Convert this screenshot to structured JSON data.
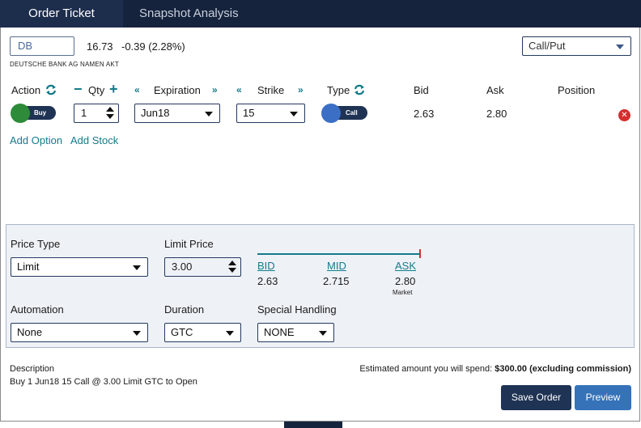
{
  "tabs": [
    {
      "label": "Order Ticket",
      "active": true
    },
    {
      "label": "Snapshot Analysis",
      "active": false
    }
  ],
  "quote": {
    "symbol": "DB",
    "last": "16.73",
    "change": "-0.39 (2.28%)",
    "company": "DEUTSCHE BANK AG NAMEN AKT"
  },
  "strategy_select": {
    "value": "Call/Put"
  },
  "leg_headers": {
    "action": "Action",
    "qty": "Qty",
    "expiration": "Expiration",
    "strike": "Strike",
    "type": "Type",
    "bid": "Bid",
    "ask": "Ask",
    "position": "Position"
  },
  "leg": {
    "action": "Buy",
    "qty": "1",
    "expiration": "Jun18",
    "strike": "15",
    "type": "Call",
    "bid": "2.63",
    "ask": "2.80"
  },
  "links": {
    "add_option": "Add Option",
    "add_stock": "Add Stock"
  },
  "order": {
    "price_type_label": "Price Type",
    "price_type": "Limit",
    "limit_price_label": "Limit Price",
    "limit_price": "3.00",
    "automation_label": "Automation",
    "automation": "None",
    "duration_label": "Duration",
    "duration": "GTC",
    "special_handling_label": "Special Handling",
    "special_handling": "NONE"
  },
  "price_bar": {
    "bid_label": "BID",
    "bid": "2.63",
    "mid_label": "MID",
    "mid": "2.715",
    "ask_label": "ASK",
    "ask": "2.80",
    "ask_note": "Market"
  },
  "description": {
    "label": "Description",
    "text": "Buy 1 Jun18 15 Call @ 3.00 Limit GTC to Open"
  },
  "estimate": {
    "label": "Estimated amount you will spend:",
    "amount": "$300.00 (excluding commission)"
  },
  "buttons": {
    "save_order": "Save Order",
    "preview": "Preview"
  },
  "colors": {
    "navy": "#16233d",
    "teal": "#157a8a",
    "buy_green": "#2e8b3a",
    "call_blue": "#3b6fc6",
    "remove_red": "#d32f2f",
    "preview_blue": "#3572b8"
  }
}
